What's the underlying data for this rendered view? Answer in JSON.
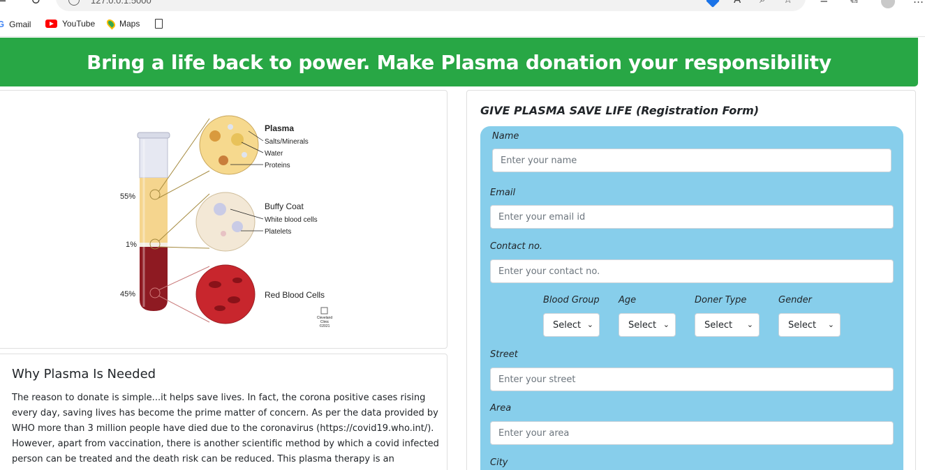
{
  "browser": {
    "address": "127.0.0.1:5000",
    "bookmarks": [
      {
        "label": "Gmail",
        "icon": "gmail-icon"
      },
      {
        "label": "YouTube",
        "icon": "youtube-icon"
      },
      {
        "label": "Maps",
        "icon": "maps-icon"
      }
    ]
  },
  "banner": {
    "text": "Bring a life back to power. Make Plasma donation your responsibility",
    "color": "#28a745"
  },
  "diagram": {
    "percent_plasma": "55%",
    "percent_buffy": "1%",
    "percent_red": "45%",
    "plasma_title": "Plasma",
    "plasma_items": [
      "Salts/Minerals",
      "Water",
      "Proteins"
    ],
    "buffy_title": "Buffy Coat",
    "buffy_items": [
      "White blood cells",
      "Platelets"
    ],
    "red_title": "Red Blood Cells",
    "credit": [
      "Cleveland",
      "Clinic",
      "©2021"
    ]
  },
  "info": {
    "title": "Why Plasma Is Needed",
    "body": "The reason to donate is simple...it helps save lives. In fact, the corona positive cases rising every day, saving lives has become the prime matter of concern. As per the data provided by WHO more than 3 million people have died due to the coronavirus (https://covid19.who.int/). However, apart from vaccination, there is another scientific method by which a covid infected person can be treated and the death risk can be reduced. This plasma therapy is an experimental approach to treat corona positive patients and help them recover. This also"
  },
  "form": {
    "title": "GIVE PLASMA SAVE LIFE (Registration Form)",
    "panel_color": "#87ceeb",
    "name": {
      "label": "Name",
      "placeholder": "Enter your name"
    },
    "email": {
      "label": "Email",
      "placeholder": "Enter your email id"
    },
    "contact": {
      "label": "Contact no.",
      "placeholder": "Enter your contact no."
    },
    "blood_group": {
      "label": "Blood Group",
      "value": "Select"
    },
    "age": {
      "label": "Age",
      "value": "Select"
    },
    "donor_type": {
      "label": "Doner Type",
      "value": "Select"
    },
    "gender": {
      "label": "Gender",
      "value": "Select"
    },
    "street": {
      "label": "Street",
      "placeholder": "Enter your street"
    },
    "area": {
      "label": "Area",
      "placeholder": "Enter your area"
    },
    "city": {
      "label": "City"
    }
  }
}
